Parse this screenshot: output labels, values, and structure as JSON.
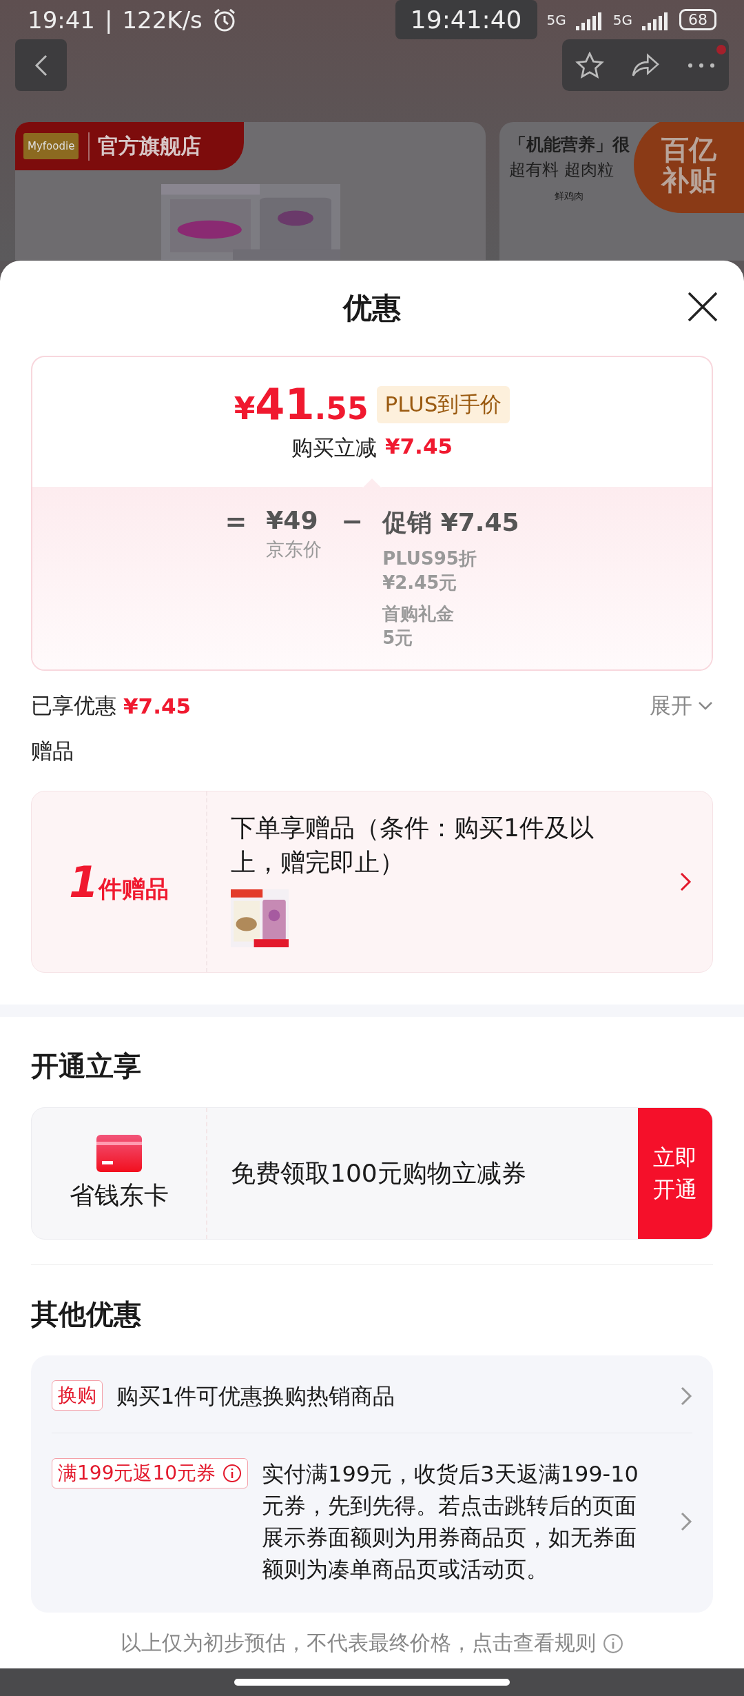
{
  "status_bar": {
    "time": "19:41",
    "separator": "|",
    "speed": "122K/s",
    "clock_overlay": "19:41:40",
    "network_1": "5G",
    "network_2": "5G",
    "battery": "68"
  },
  "background_page": {
    "brand_logo": "Myfoodie",
    "store_banner": "官方旗舰店",
    "side_card_title": "「机能营养」很",
    "side_card_subtitle": "超有料 超肉粒",
    "side_card_label": "鲜鸡肉",
    "subsidy_badge": [
      "百亿",
      "补贴"
    ]
  },
  "sheet": {
    "title": "优惠"
  },
  "price_summary": {
    "currency": "¥",
    "integer": "41",
    "decimal": ".55",
    "badge": "PLUS到手价",
    "instant_label": "购买立减",
    "instant_amount": "¥7.45",
    "equals": "=",
    "list_price": "¥49",
    "list_price_label": "京东价",
    "minus": "−",
    "promo_label": "促销",
    "promo_amount": "¥7.45",
    "promo_items": [
      {
        "name": "PLUS95折",
        "amount": "¥2.45元"
      },
      {
        "name": "首购礼金",
        "amount": "5元"
      }
    ]
  },
  "enjoyed": {
    "label": "已享优惠",
    "amount": "¥7.45",
    "toggle": "展开"
  },
  "gifts": {
    "title": "赠品",
    "count": "1",
    "count_unit": "件赠品",
    "description": "下单享赠品（条件：购买1件及以上，赠完即止）"
  },
  "membership": {
    "title": "开通立享",
    "card_name": "省钱东卡",
    "offer": "免费领取100元购物立减券",
    "action": "立即开通"
  },
  "other": {
    "title": "其他优惠",
    "items": [
      {
        "tag": "换购",
        "text": "购买1件可优惠换购热销商品",
        "info": false
      },
      {
        "tag": "满199元返10元券",
        "text": "实付满199元，收货后3天返满199-10元券，先到先得。若点击跳转后的页面展示券面额则为用券商品页，如无券面额则为凑单商品页或活动页。",
        "info": true
      }
    ]
  },
  "footer": {
    "note": "以上仅为初步预估，不代表最终价格，点击查看规则"
  }
}
